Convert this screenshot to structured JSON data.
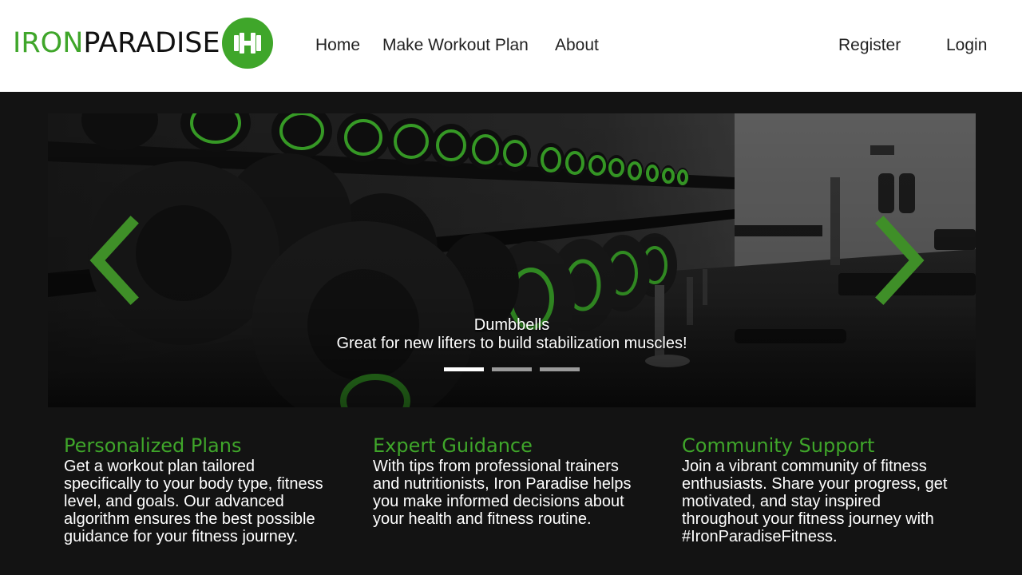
{
  "brand": {
    "name_part1": "IRON",
    "name_part2": "PARADISE",
    "logo_icon": "dumbbell-icon",
    "accent_color": "#3fa62a"
  },
  "nav": {
    "links": [
      {
        "label": "Home"
      },
      {
        "label": "Make Workout Plan"
      },
      {
        "label": "About"
      }
    ],
    "register_label": "Register",
    "login_label": "Login"
  },
  "carousel": {
    "slide": {
      "title": "Dumbbells",
      "text": "Great for new lifters to build stabilization muscles!"
    },
    "prev_icon": "chevron-left-icon",
    "next_icon": "chevron-right-icon",
    "indicator_count": 3,
    "active_indicator": 1
  },
  "features": [
    {
      "title": "Personalized Plans",
      "body": "Get a workout plan tailored specifically to your body type, fitness level, and goals. Our advanced algorithm ensures the best possible guidance for your fitness journey."
    },
    {
      "title": "Expert Guidance",
      "body": "With tips from professional trainers and nutritionists, Iron Paradise helps you make informed decisions about your health and fitness routine."
    },
    {
      "title": "Community Support",
      "body": "Join a vibrant community of fitness enthusiasts. Share your progress, get motivated, and stay inspired throughout your fitness journey with #IronParadiseFitness."
    }
  ]
}
